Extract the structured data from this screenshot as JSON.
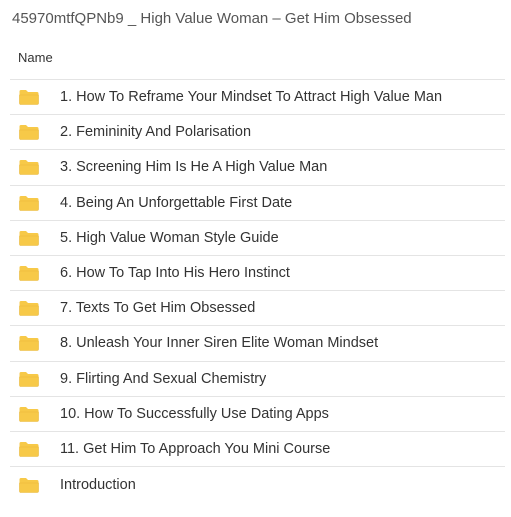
{
  "window": {
    "title": "45970mtfQPNb9 _ High Value Woman – Get Him Obsessed"
  },
  "list": {
    "header_name": "Name",
    "folder_color": "#F7C948",
    "items": [
      {
        "label": "1. How To Reframe Your Mindset To Attract High Value Man",
        "icon": "folder-icon"
      },
      {
        "label": "2. Femininity And Polarisation",
        "icon": "folder-icon"
      },
      {
        "label": "3. Screening Him Is He A High Value Man",
        "icon": "folder-icon"
      },
      {
        "label": "4. Being An Unforgettable First Date",
        "icon": "folder-icon"
      },
      {
        "label": "5. High Value Woman Style Guide",
        "icon": "folder-icon"
      },
      {
        "label": "6. How To Tap Into His Hero Instinct",
        "icon": "folder-icon"
      },
      {
        "label": "7. Texts To Get Him Obsessed",
        "icon": "folder-icon"
      },
      {
        "label": "8. Unleash Your Inner Siren Elite Woman Mindset",
        "icon": "folder-icon"
      },
      {
        "label": "9. Flirting And Sexual Chemistry",
        "icon": "folder-icon"
      },
      {
        "label": "10. How To Successfully Use Dating Apps",
        "icon": "folder-icon"
      },
      {
        "label": "11. Get Him To Approach You Mini Course",
        "icon": "folder-icon"
      },
      {
        "label": "Introduction",
        "icon": "folder-icon"
      }
    ]
  }
}
